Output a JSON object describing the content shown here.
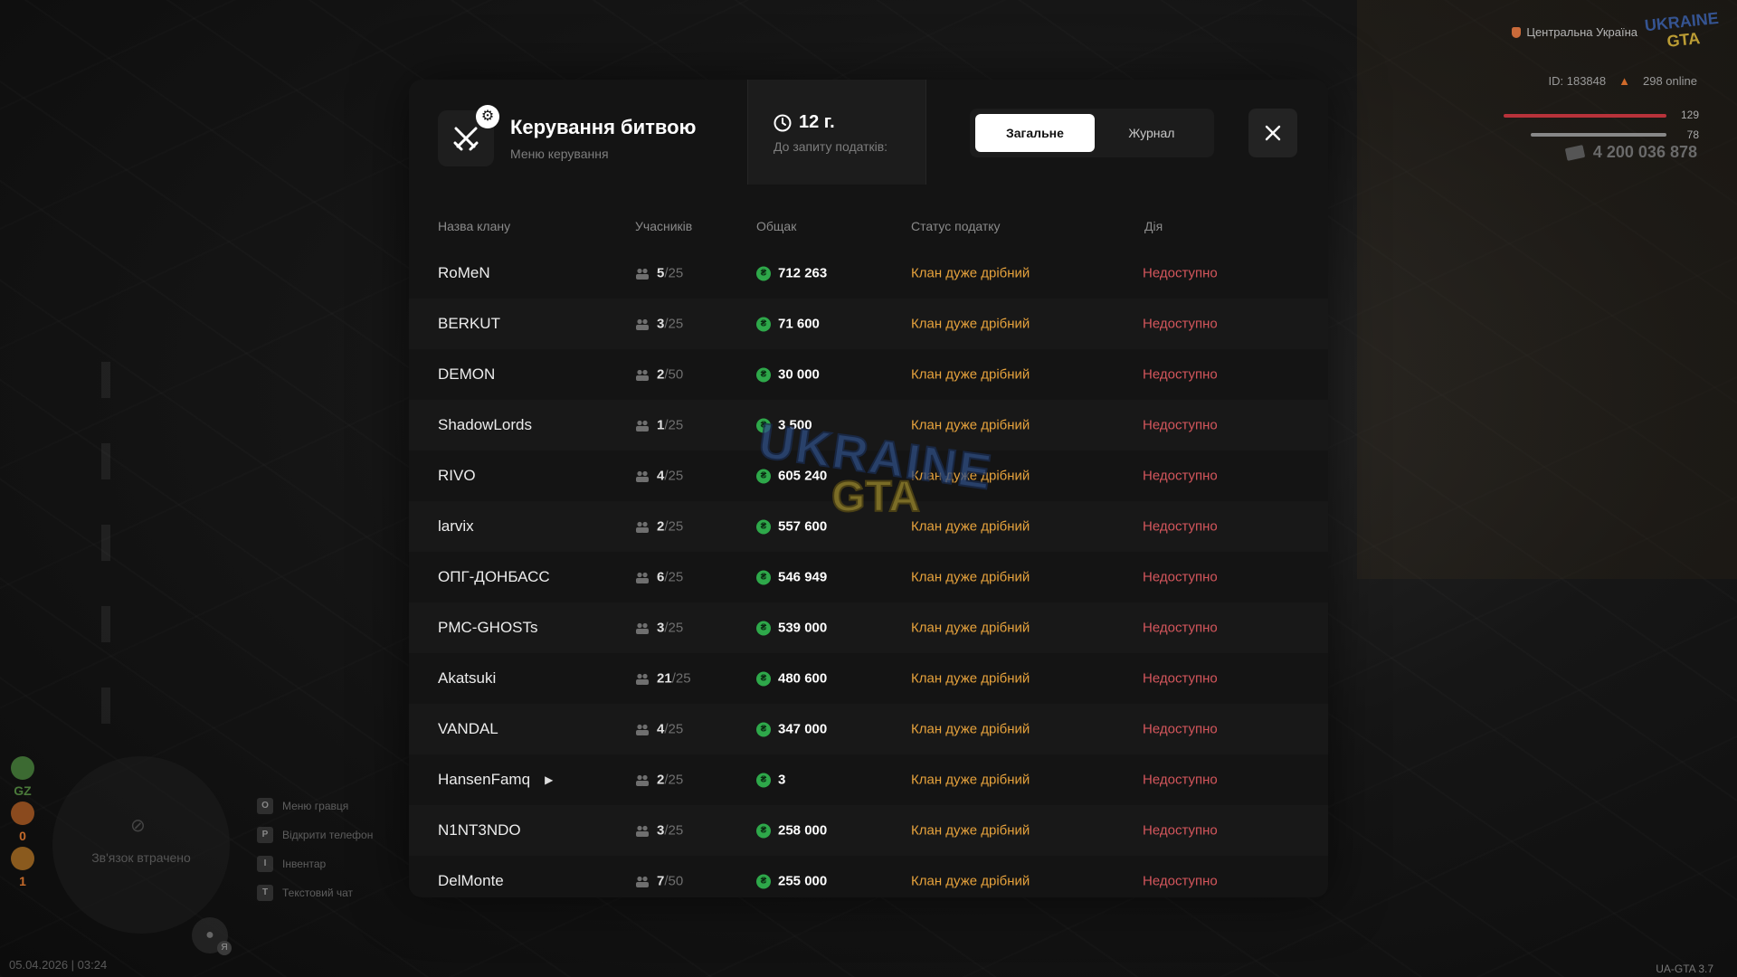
{
  "hud": {
    "region": "Центральна Україна",
    "logo_top": "UKRAINE",
    "logo_bottom": "GTA",
    "player_id": "ID: 183848",
    "online": "298 online",
    "health": "129",
    "armor": "78",
    "money": "4 200 036 878",
    "left_status": [
      "GZ",
      "0",
      "1"
    ],
    "minimap_text": "Зв'язок втрачено",
    "mic_badge": "Я",
    "date": "05.04.2026 | 03:24",
    "version": "UA-GTA 3.7",
    "keys": [
      {
        "key": "O",
        "label": "Меню гравця"
      },
      {
        "key": "P",
        "label": "Відкрити телефон"
      },
      {
        "key": "I",
        "label": "Інвентар"
      },
      {
        "key": "T",
        "label": "Текстовий чат"
      }
    ]
  },
  "modal": {
    "title": "Керування битвою",
    "subtitle": "Меню керування",
    "timer_value": "12 г.",
    "timer_label": "До запиту податків:",
    "tabs": [
      {
        "label": "Загальне",
        "active": true
      },
      {
        "label": "Журнал",
        "active": false
      }
    ],
    "columns": {
      "name": "Назва клану",
      "members": "Учасників",
      "fund": "Общак",
      "status": "Статус податку",
      "action": "Дія"
    },
    "rows": [
      {
        "name": "RoMeN",
        "members": "5",
        "max": "/25",
        "fund": "712 263",
        "status": "Клан дуже дрібний",
        "action": "Недоступно"
      },
      {
        "name": "BERKUT",
        "members": "3",
        "max": "/25",
        "fund": "71 600",
        "status": "Клан дуже дрібний",
        "action": "Недоступно"
      },
      {
        "name": "DEMON",
        "members": "2",
        "max": "/50",
        "fund": "30 000",
        "status": "Клан дуже дрібний",
        "action": "Недоступно"
      },
      {
        "name": "ShadowLords",
        "members": "1",
        "max": "/25",
        "fund": "3 500",
        "status": "Клан дуже дрібний",
        "action": "Недоступно"
      },
      {
        "name": "RIVO",
        "members": "4",
        "max": "/25",
        "fund": "605 240",
        "status": "Клан дуже дрібний",
        "action": "Недоступно"
      },
      {
        "name": "larvix",
        "members": "2",
        "max": "/25",
        "fund": "557 600",
        "status": "Клан дуже дрібний",
        "action": "Недоступно"
      },
      {
        "name": "ОПГ-ДОНБАСС",
        "members": "6",
        "max": "/25",
        "fund": "546 949",
        "status": "Клан дуже дрібний",
        "action": "Недоступно"
      },
      {
        "name": "PMC-GHOSTs",
        "members": "3",
        "max": "/25",
        "fund": "539 000",
        "status": "Клан дуже дрібний",
        "action": "Недоступно"
      },
      {
        "name": "Akatsuki",
        "members": "21",
        "max": "/25",
        "fund": "480 600",
        "status": "Клан дуже дрібний",
        "action": "Недоступно"
      },
      {
        "name": "VANDAL",
        "members": "4",
        "max": "/25",
        "fund": "347 000",
        "status": "Клан дуже дрібний",
        "action": "Недоступно"
      },
      {
        "name": "HansenFamq",
        "members": "2",
        "max": "/25",
        "fund": "3",
        "status": "Клан дуже дрібний",
        "action": "Недоступно"
      },
      {
        "name": "N1NT3NDO",
        "members": "3",
        "max": "/25",
        "fund": "258 000",
        "status": "Клан дуже дрібний",
        "action": "Недоступно"
      },
      {
        "name": "DelMonte",
        "members": "7",
        "max": "/50",
        "fund": "255 000",
        "status": "Клан дуже дрібний",
        "action": "Недоступно"
      }
    ]
  },
  "watermark": {
    "top": "UKRAINE",
    "bottom": "GTA"
  },
  "colors": {
    "accent_status": "#e6a23c",
    "unavailable": "#d4565c",
    "coin": "#2ea84a",
    "panel": "#141414"
  }
}
